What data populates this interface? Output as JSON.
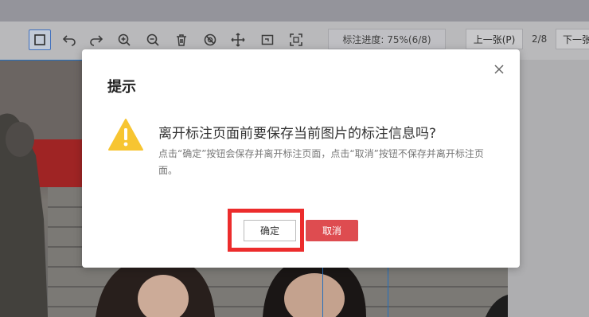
{
  "toolbar": {
    "tools": [
      {
        "icon": "rectangle-select-icon",
        "active": true
      },
      {
        "icon": "undo-icon"
      },
      {
        "icon": "redo-icon"
      },
      {
        "icon": "zoom-in-icon"
      },
      {
        "icon": "zoom-out-icon"
      },
      {
        "icon": "delete-icon"
      },
      {
        "icon": "hide-icon"
      },
      {
        "icon": "move-icon"
      },
      {
        "icon": "fit-icon"
      },
      {
        "icon": "fullscreen-icon"
      }
    ],
    "progress_label": "标注进度: 75%(6/8)",
    "prev_label": "上一张(P)",
    "page_count": "2/8",
    "next_label": "下一张"
  },
  "dialog": {
    "title": "提示",
    "message": "离开标注页面前要保存当前图片的标注信息吗?",
    "description": "点击“确定”按钮会保存并离开标注页面，点击“取消”按钮不保存并离开标注页面。",
    "ok_label": "确定",
    "cancel_label": "取消",
    "icon": "warning-icon",
    "close_icon": "close-icon"
  },
  "colors": {
    "accent": "#4a80d8",
    "cancel_button": "#de4c50",
    "highlight": "#ec2c2c",
    "warning": "#f7c531"
  }
}
